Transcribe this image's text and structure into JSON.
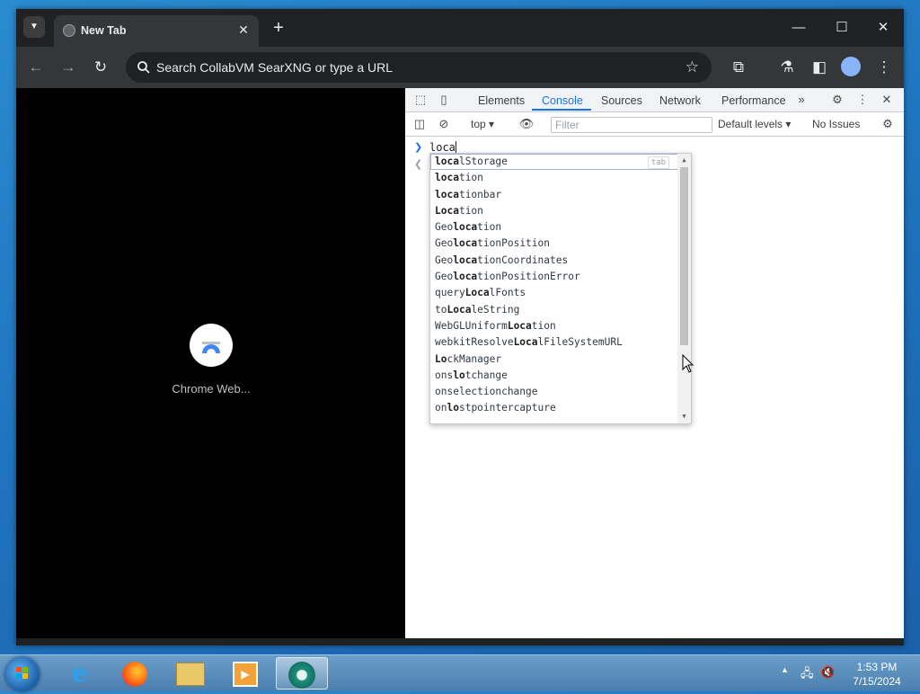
{
  "browser": {
    "tab_title": "New Tab",
    "omnibox_text": "Search CollabVM SearXNG or type a URL"
  },
  "page": {
    "shortcut_label": "Chrome Web..."
  },
  "devtools": {
    "tabs": [
      "Elements",
      "Console",
      "Sources",
      "Network",
      "Performance"
    ],
    "active_tab": "Console",
    "context": "top",
    "filter_placeholder": "Filter",
    "levels": "Default levels",
    "issues": "No Issues",
    "prompt_input": "loca",
    "autocomplete": [
      {
        "pre": "",
        "match": "loca",
        "post": "lStorage"
      },
      {
        "pre": "",
        "match": "loca",
        "post": "tion"
      },
      {
        "pre": "",
        "match": "loca",
        "post": "tionbar"
      },
      {
        "pre": "",
        "match": "Loca",
        "post": "tion"
      },
      {
        "pre": "Geo",
        "match": "loca",
        "post": "tion"
      },
      {
        "pre": "Geo",
        "match": "loca",
        "post": "tionPosition"
      },
      {
        "pre": "Geo",
        "match": "loca",
        "post": "tionCoordinates"
      },
      {
        "pre": "Geo",
        "match": "loca",
        "post": "tionPositionError"
      },
      {
        "pre": "query",
        "match": "Loca",
        "post": "lFonts"
      },
      {
        "pre": "to",
        "match": "Loca",
        "post": "leString"
      },
      {
        "pre": "WebGLUniform",
        "match": "Loca",
        "post": "tion"
      },
      {
        "pre": "webkitResolve",
        "match": "Loca",
        "post": "lFileSystemURL"
      },
      {
        "pre": "",
        "match": "Lo",
        "post": "ckManager"
      },
      {
        "pre": "ons",
        "match": "lo",
        "post": "tchange"
      },
      {
        "pre": "onselectionchange",
        "match": "",
        "post": ""
      },
      {
        "pre": "on",
        "match": "lo",
        "post": "stpointercapture"
      }
    ],
    "tab_hint": "tab"
  },
  "taskbar": {
    "time": "1:53 PM",
    "date": "7/15/2024"
  }
}
